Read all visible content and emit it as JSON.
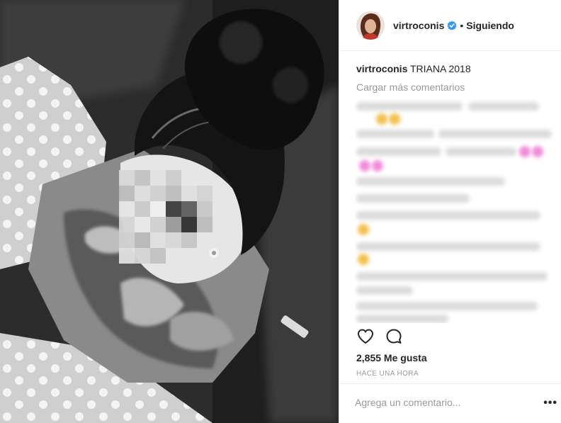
{
  "post": {
    "username": "virtroconis",
    "follow_status": "Siguiendo",
    "separator": "•",
    "caption_user": "virtroconis",
    "caption_text": "TRIANA 2018",
    "load_more": "Cargar más comentarios",
    "likes": "2,855 Me gusta",
    "timestamp": "HACE UNA HORA",
    "comment_placeholder": "Agrega un comentario...",
    "more_options": "•••"
  },
  "icons": {
    "verified": "verified-badge-icon",
    "like": "heart-icon",
    "comment": "comment-icon",
    "more": "more-options-icon"
  },
  "colors": {
    "verified_blue": "#3897f0",
    "muted_text": "#999999",
    "text": "#262626",
    "divider": "#efefef"
  }
}
